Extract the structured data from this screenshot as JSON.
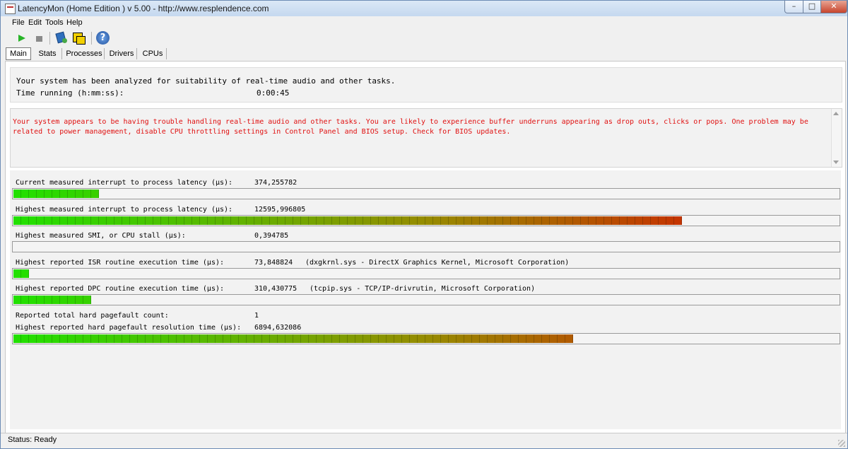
{
  "window": {
    "title": "LatencyMon  (Home Edition )  v 5.00 - http://www.resplendence.com"
  },
  "menu": {
    "file": "File",
    "edit": "Edit",
    "tools": "Tools",
    "help": "Help"
  },
  "toolbar": {
    "icons": [
      "start-icon",
      "stop-icon",
      "tools-icon",
      "cpu-icon",
      "help-icon"
    ],
    "help_glyph": "?"
  },
  "tabs": [
    "Main",
    "Stats",
    "Processes",
    "Drivers",
    "CPUs"
  ],
  "info": {
    "line1": "Your system has been analyzed for suitability of real-time audio and other tasks.",
    "time_label": "Time running (h:mm:ss):",
    "time_value": "0:00:45"
  },
  "warning": {
    "text": "Your system appears to be having trouble handling real-time audio and other tasks. You are likely to experience buffer underruns appearing as drop outs, clicks or pops. One problem may be related to power management, disable CPU throttling settings in Control Panel and BIOS setup. Check for BIOS updates.",
    "color": "#e01010"
  },
  "metrics": [
    {
      "label": "Current measured interrupt to process latency (µs):",
      "value": "374,255782",
      "detail": "",
      "bar_fraction": 0.1
    },
    {
      "label": "Highest measured interrupt to process latency (µs):",
      "value": "12595,996805",
      "detail": "",
      "bar_fraction": 0.81
    },
    {
      "label": "Highest measured SMI, or CPU stall (µs):",
      "value": "0,394785",
      "detail": "",
      "bar_fraction": 0.0
    },
    {
      "label": "Highest reported ISR routine execution time (µs):",
      "value": "73,848824",
      "detail": "(dxgkrnl.sys - DirectX Graphics Kernel, Microsoft Corporation)",
      "bar_fraction": 0.02
    },
    {
      "label": "Highest reported DPC routine execution time (µs):",
      "value": "310,430775",
      "detail": "(tcpip.sys - TCP/IP-drivrutin, Microsoft Corporation)",
      "bar_fraction": 0.09
    },
    {
      "label": "Reported total hard pagefault count:",
      "value": "1",
      "detail": ""
    },
    {
      "label": "Highest reported hard pagefault resolution time (µs):",
      "value": "6894,632086",
      "detail": "",
      "bar_fraction": 0.68
    }
  ],
  "colors": {
    "bar_start": "#22e000",
    "bar_end": "#e00000",
    "bar_empty": "#f4f4f4"
  },
  "status": {
    "text": "Status: Ready"
  }
}
